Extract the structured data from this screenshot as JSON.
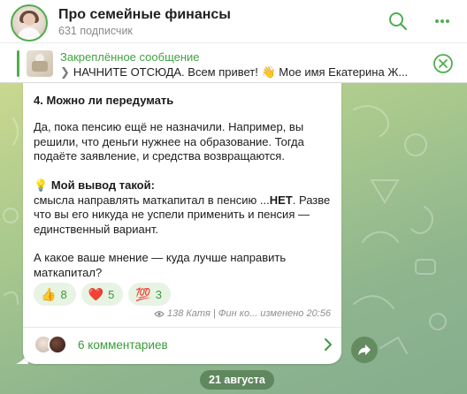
{
  "channel": {
    "title": "Про семейные финансы",
    "subscribers": "631 подписчик"
  },
  "pinned": {
    "title": "Закреплённое сообщение",
    "text": "НАЧНИТЕ ОТСЮДА.  Всем привет! 👋 Мое имя Екатерина Ж..."
  },
  "message": {
    "heading": "4. Можно ли передумать",
    "paragraph1": "Да, пока пенсию ещё не назначили. Например, вы решили, что деньги нужнее на образование. Тогда подаёте заявление, и средства возвращаются.",
    "conclusion_emoji": "💡",
    "conclusion_title": "Мой вывод такой:",
    "conclusion_line1_pre": "смысла направлять маткапитал в пенсию ...",
    "conclusion_line1_bold": "НЕТ",
    "conclusion_line1_post": ".",
    "conclusion_rest": "Разве что вы его никуда не успели применить и пенсия — единственный вариант.",
    "question": "А какое ваше мнение — куда лучше направить маткапитал?",
    "reactions": [
      {
        "emoji": "👍",
        "count": "8"
      },
      {
        "emoji": "❤️",
        "count": "5"
      },
      {
        "emoji": "💯",
        "count": "3"
      }
    ],
    "views": "138",
    "meta_text": "Катя | Фин ко... изменено 20:56",
    "comments_label": "6 комментариев"
  },
  "date_divider": "21 августа",
  "colors": {
    "accent": "#4fae4e",
    "link": "#3a9a3a"
  }
}
